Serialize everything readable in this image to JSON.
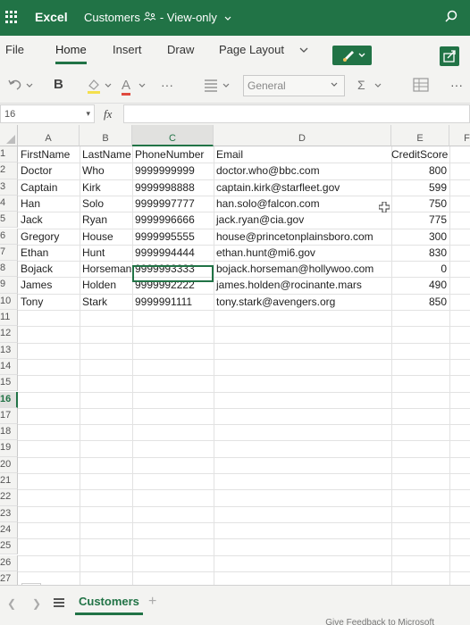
{
  "titlebar": {
    "app": "Excel",
    "doc_name": "Customers",
    "mode": "- View-only"
  },
  "tabs": [
    "File",
    "Home",
    "Insert",
    "Draw",
    "Page Layout"
  ],
  "active_tab": "Home",
  "toolbar": {
    "bold": "B",
    "font_color": "A",
    "more": "···",
    "number_format": "General",
    "autosum": "Σ",
    "overflow": "···"
  },
  "formula": {
    "namebox": "16",
    "fx": "fx",
    "value": ""
  },
  "columns": [
    "A",
    "B",
    "C",
    "D",
    "E",
    "F"
  ],
  "selected_column": "C",
  "rows": [
    "1",
    "2",
    "3",
    "4",
    "5",
    "6",
    "7",
    "8",
    "9",
    "10",
    "11",
    "12",
    "13",
    "14",
    "15",
    "16",
    "17",
    "18",
    "19",
    "20",
    "21",
    "22",
    "23",
    "24",
    "25",
    "26",
    "27"
  ],
  "selected_row": "16",
  "table": {
    "headers": [
      "FirstName",
      "LastName",
      "PhoneNumber",
      "Email",
      "CreditScore"
    ],
    "records": [
      [
        "Doctor",
        "Who",
        "9999999999",
        "doctor.who@bbc.com",
        "800"
      ],
      [
        "Captain",
        "Kirk",
        "9999998888",
        "captain.kirk@starfleet.gov",
        "599"
      ],
      [
        "Han",
        "Solo",
        "9999997777",
        "han.solo@falcon.com",
        "750"
      ],
      [
        "Jack",
        "Ryan",
        "9999996666",
        "jack.ryan@cia.gov",
        "775"
      ],
      [
        "Gregory",
        "House",
        "9999995555",
        "house@princetonplainsboro.com",
        "300"
      ],
      [
        "Ethan",
        "Hunt",
        "9999994444",
        "ethan.hunt@mi6.gov",
        "830"
      ],
      [
        "Bojack",
        "Horseman",
        "9999993333",
        "bojack.horseman@hollywoo.com",
        "0"
      ],
      [
        "James",
        "Holden",
        "9999992222",
        "james.holden@rocinante.mars",
        "490"
      ],
      [
        "Tony",
        "Stark",
        "9999991111",
        "tony.stark@avengers.org",
        "850"
      ]
    ]
  },
  "sheet": {
    "name": "Customers",
    "add": "+"
  },
  "footer": {
    "feedback": "Give Feedback to Microsoft"
  },
  "colors": {
    "excel_green": "#217346",
    "grid_line": "#e2e2e2"
  }
}
